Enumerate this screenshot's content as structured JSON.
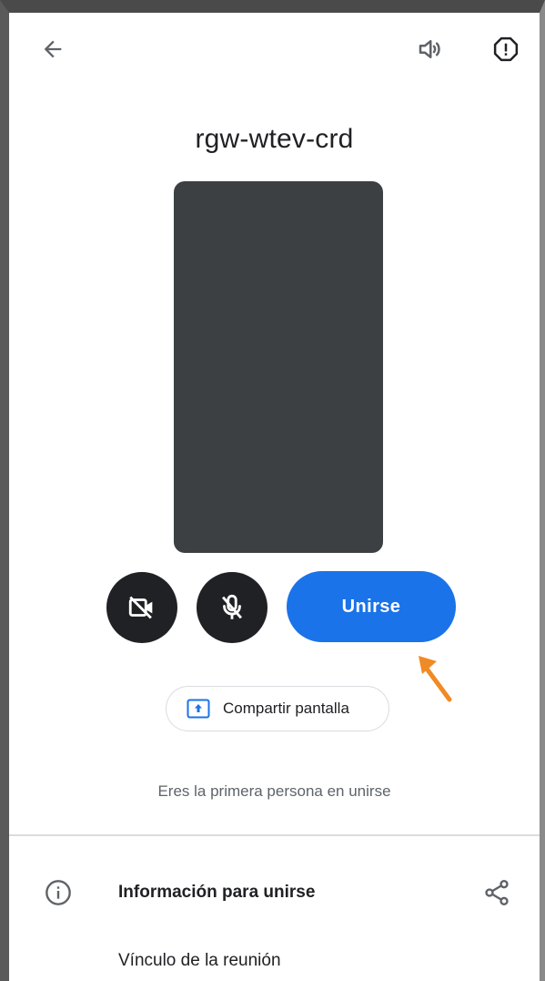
{
  "meeting": {
    "code": "rgw-wtev-crd",
    "status": "Eres la primera persona en unirse"
  },
  "controls": {
    "camera_icon": "videocam-off-icon",
    "mic_icon": "mic-off-icon",
    "join_label": "Unirse",
    "share_label": "Compartir pantalla"
  },
  "topbar": {
    "back_icon": "arrow-back-icon",
    "speaker_icon": "volume-icon",
    "report_icon": "report-icon"
  },
  "details": {
    "info_label": "Información para unirse",
    "link_label": "Vínculo de la reunión"
  },
  "colors": {
    "accent": "#1a73e8",
    "preview_bg": "#3c4043",
    "control_bg": "#202124",
    "annotation": "#f08a24"
  }
}
